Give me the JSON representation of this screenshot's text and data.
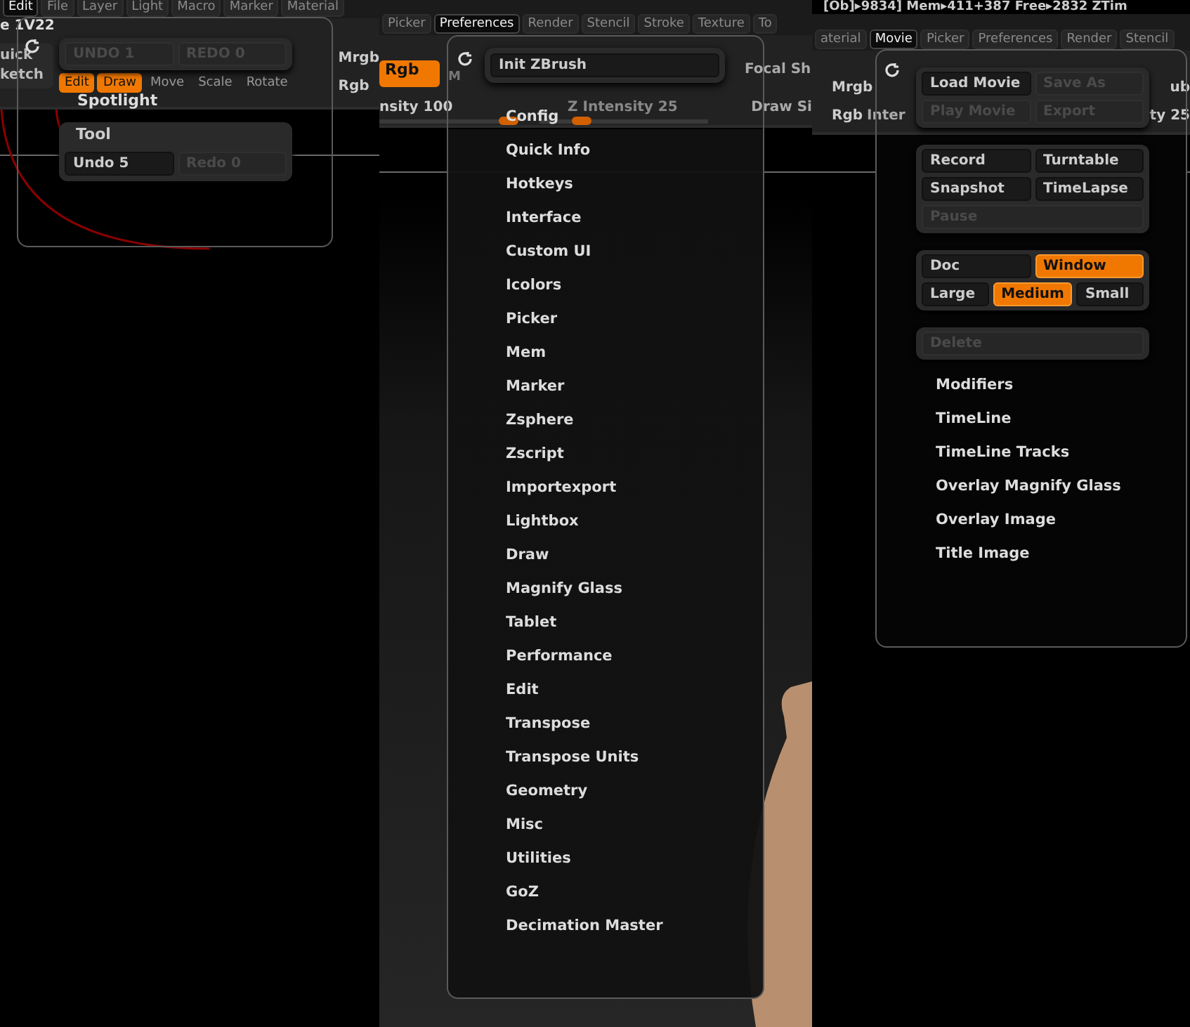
{
  "left": {
    "tabs": [
      {
        "label": "Edit",
        "selected": true
      },
      {
        "label": "File",
        "selected": false
      },
      {
        "label": "Layer",
        "selected": false
      },
      {
        "label": "Light",
        "selected": false
      },
      {
        "label": "Macro",
        "selected": false
      },
      {
        "label": "Marker",
        "selected": false
      },
      {
        "label": "Material",
        "selected": false
      }
    ],
    "title": "e 1V22",
    "quick_sketch": [
      "uick",
      "ketch"
    ],
    "tools": [
      {
        "label": "Edit",
        "selected": true
      },
      {
        "label": "Draw",
        "selected": true
      },
      {
        "label": "Move",
        "selected": false
      },
      {
        "label": "Scale",
        "selected": false
      },
      {
        "label": "Rotate",
        "selected": false
      }
    ],
    "side": [
      "Mrgb",
      "Rgb"
    ],
    "popup": {
      "buttons": [
        {
          "label": "UNDO 1",
          "disabled": true
        },
        {
          "label": "REDO 0",
          "disabled": true
        }
      ],
      "label": "Spotlight",
      "group": {
        "title": "Tool",
        "buttons": [
          {
            "label": "Undo 5",
            "disabled": false
          },
          {
            "label": "Redo 0",
            "disabled": true
          }
        ]
      }
    }
  },
  "middle": {
    "tabs": [
      {
        "label": "Picker",
        "selected": false
      },
      {
        "label": "Preferences",
        "selected": true
      },
      {
        "label": "Render",
        "selected": false
      },
      {
        "label": "Stencil",
        "selected": false
      },
      {
        "label": "Stroke",
        "selected": false
      },
      {
        "label": "Texture",
        "selected": false
      },
      {
        "label": "To",
        "selected": false
      }
    ],
    "rgb": {
      "label": "Rgb",
      "selected": true
    },
    "m": "M",
    "side": [
      "Focal Sh",
      "Draw Si"
    ],
    "sliders": [
      {
        "label": "nsity 100",
        "level": 1
      },
      {
        "label": "Z Intensity 25",
        "level": 0.25
      }
    ],
    "popup": {
      "button": "Init ZBrush",
      "items": [
        "Config",
        "Quick Info",
        "Hotkeys",
        "Interface",
        "Custom UI",
        "Icolors",
        "Picker",
        "Mem",
        "Marker",
        "Zsphere",
        "Zscript",
        "Importexport",
        "Lightbox",
        "Draw",
        "Magnify Glass",
        "Tablet",
        "Performance",
        "Edit",
        "Transpose",
        "Transpose Units",
        "Geometry",
        "Misc",
        "Utilities",
        "GoZ",
        "Decimation Master"
      ]
    }
  },
  "right": {
    "status": "[Ob]▸9834] Mem▸411+387 Free▸2832 ZTim",
    "tabs": [
      {
        "label": "aterial",
        "selected": false
      },
      {
        "label": "Movie",
        "selected": true
      },
      {
        "label": "Picker",
        "selected": false
      },
      {
        "label": "Preferences",
        "selected": false
      },
      {
        "label": "Render",
        "selected": false
      },
      {
        "label": "Stencil",
        "selected": false
      }
    ],
    "background": [
      "Mrgb",
      "ub",
      "Rgb",
      "Inter",
      "ty 25"
    ],
    "popup": {
      "groups": [
        {
          "rows": [
            [
              {
                "label": "Load Movie",
                "disabled": false,
                "selected": false
              },
              {
                "label": "Save As",
                "disabled": true,
                "selected": false
              }
            ],
            [
              {
                "label": "Play Movie",
                "disabled": true,
                "selected": false
              },
              {
                "label": "Export",
                "disabled": true,
                "selected": false
              }
            ]
          ]
        },
        {
          "rows": [
            [
              {
                "label": "Record",
                "disabled": false,
                "selected": false
              },
              {
                "label": "Turntable",
                "disabled": false,
                "selected": false
              }
            ],
            [
              {
                "label": "Snapshot",
                "disabled": false,
                "selected": false
              },
              {
                "label": "TimeLapse",
                "disabled": false,
                "selected": false
              }
            ],
            [
              {
                "label": "Pause",
                "disabled": true,
                "selected": false
              }
            ]
          ]
        },
        {
          "rows": [
            [
              {
                "label": "Doc",
                "disabled": false,
                "selected": false
              },
              {
                "label": "Window",
                "disabled": false,
                "selected": true
              }
            ],
            [
              {
                "label": "Large",
                "disabled": false,
                "selected": false
              },
              {
                "label": "Medium",
                "disabled": false,
                "selected": true
              },
              {
                "label": "Small",
                "disabled": false,
                "selected": false
              }
            ]
          ]
        },
        {
          "rows": [
            [
              {
                "label": "Delete",
                "disabled": true,
                "selected": false
              }
            ]
          ]
        }
      ],
      "items": [
        "Modifiers",
        "TimeLine",
        "TimeLine Tracks",
        "Overlay Magnify Glass",
        "Overlay Image",
        "Title Image"
      ]
    }
  }
}
